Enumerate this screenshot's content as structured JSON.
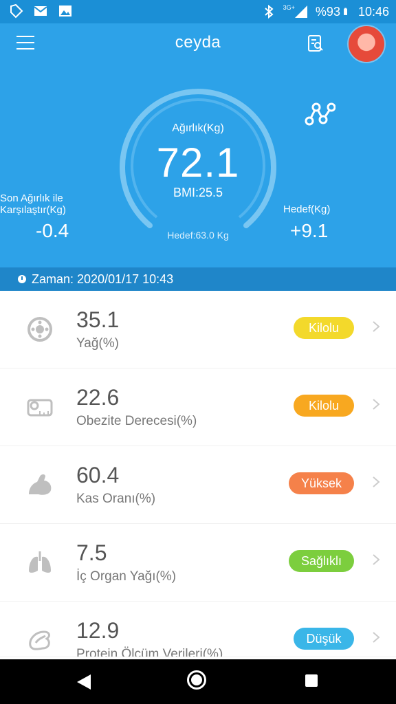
{
  "status_bar": {
    "network": "3G+",
    "battery": "%93",
    "time": "10:46"
  },
  "header": {
    "title": "ceyda",
    "gauge_title": "Ağırlık(Kg)",
    "weight": "72.1",
    "bmi": "BMI:25.5",
    "target": "Hedef:63.0 Kg",
    "compare_label_line1": "Son Ağırlık ile",
    "compare_label_line2": "Karşılaştır(Kg)",
    "compare_value": "-0.4",
    "goal_label": "Hedef(Kg)",
    "goal_value": "+9.1"
  },
  "time_bar": {
    "text": "Zaman: 2020/01/17 10:43"
  },
  "metrics": [
    {
      "value": "35.1",
      "label": "Yağ(%)",
      "badge": "Kilolu",
      "badge_color": "#f3d92b",
      "icon": "fat-icon"
    },
    {
      "value": "22.6",
      "label": "Obezite Derecesi(%)",
      "badge": "Kilolu",
      "badge_color": "#f8a820",
      "icon": "tape-measure-icon"
    },
    {
      "value": "60.4",
      "label": "Kas Oranı(%)",
      "badge": "Yüksek",
      "badge_color": "#f5814a",
      "icon": "muscle-icon"
    },
    {
      "value": "7.5",
      "label": "İç Organ Yağı(%)",
      "badge": "Sağlıklı",
      "badge_color": "#7cce3e",
      "icon": "lungs-icon"
    },
    {
      "value": "12.9",
      "label": "Protein Ölçüm Verileri(%)",
      "badge": "Düşük",
      "badge_color": "#3ab6e8",
      "icon": "protein-icon"
    }
  ],
  "colors": {
    "header_bg": "#2da2e8",
    "status_bg": "#1b8fd6",
    "time_bar_bg": "#1f86c9"
  }
}
